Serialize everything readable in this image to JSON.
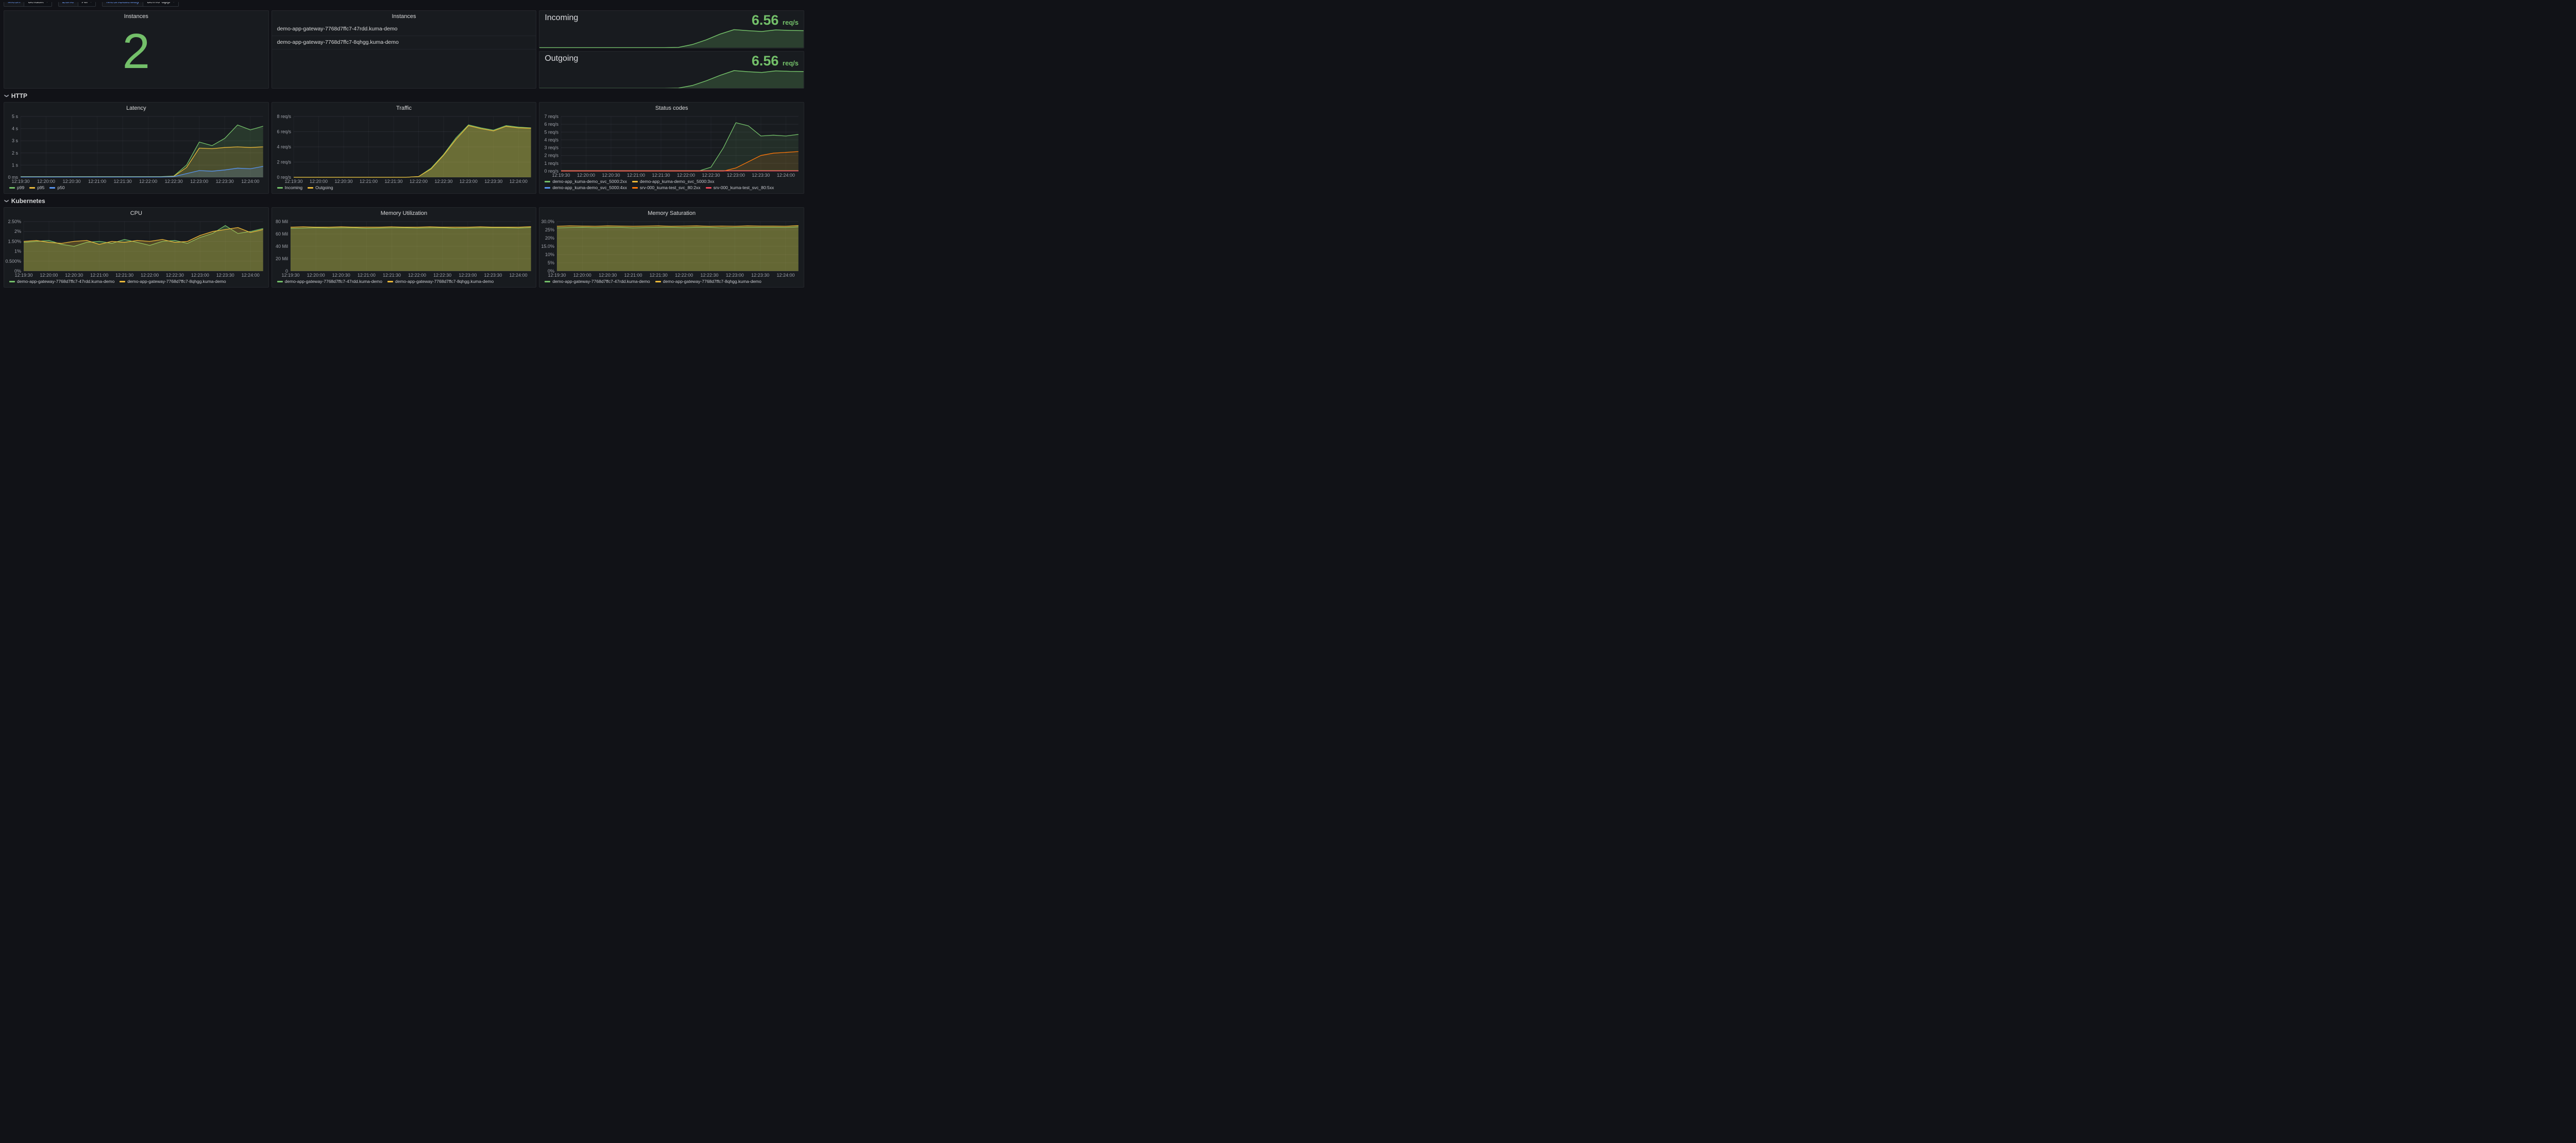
{
  "colors": {
    "green": "#73BF69",
    "yellow": "#EAB839",
    "blue": "#5794F2",
    "orange": "#FF780A",
    "red": "#F2495C"
  },
  "topbar": {
    "filters": [
      {
        "label": "Mesh",
        "value": "default"
      },
      {
        "label": "Zone",
        "value": "All"
      },
      {
        "label": "MeshGateway",
        "value": "demo-app"
      }
    ]
  },
  "sections": [
    {
      "title": "HTTP"
    },
    {
      "title": "Kubernetes"
    }
  ],
  "panels": {
    "instances_stat": {
      "title": "Instances",
      "value": "2"
    },
    "instances_list": {
      "title": "Instances",
      "items": [
        "demo-app-gateway-7768d7ffc7-47rdd.kuma-demo",
        "demo-app-gateway-7768d7ffc7-8qhgg.kuma-demo"
      ]
    },
    "incoming": {
      "title": "Incoming",
      "value": "6.56",
      "unit": "req/s"
    },
    "outgoing": {
      "title": "Outgoing",
      "value": "6.56",
      "unit": "req/s"
    }
  },
  "chart_data": [
    {
      "type": "line",
      "title": "Latency",
      "ylim": [
        0,
        5
      ],
      "yticks": [
        [
          0,
          "0 ms"
        ],
        [
          1,
          "1 s"
        ],
        [
          2,
          "2 s"
        ],
        [
          3,
          "3 s"
        ],
        [
          4,
          "4 s"
        ],
        [
          5,
          "5 s"
        ]
      ],
      "x_labels": [
        "12:19:30",
        "12:20:00",
        "12:20:30",
        "12:21:00",
        "12:21:30",
        "12:22:00",
        "12:22:30",
        "12:23:00",
        "12:23:30",
        "12:24:00"
      ],
      "x_label_step": 2,
      "series": [
        {
          "name": "p99",
          "color": "#73BF69",
          "values": [
            0.05,
            0.05,
            0.05,
            0.05,
            0.05,
            0.05,
            0.05,
            0.05,
            0.05,
            0.05,
            0.05,
            0.05,
            0.1,
            1.0,
            2.9,
            2.6,
            3.2,
            4.3,
            3.9,
            4.2
          ]
        },
        {
          "name": "p95",
          "color": "#EAB839",
          "values": [
            0.03,
            0.03,
            0.03,
            0.03,
            0.03,
            0.03,
            0.03,
            0.03,
            0.03,
            0.03,
            0.03,
            0.03,
            0.08,
            0.8,
            2.4,
            2.35,
            2.45,
            2.5,
            2.45,
            2.5
          ]
        },
        {
          "name": "p50",
          "color": "#5794F2",
          "values": [
            0.02,
            0.02,
            0.02,
            0.02,
            0.02,
            0.02,
            0.02,
            0.02,
            0.02,
            0.02,
            0.02,
            0.02,
            0.05,
            0.3,
            0.55,
            0.5,
            0.6,
            0.75,
            0.7,
            0.9
          ]
        }
      ]
    },
    {
      "type": "area",
      "title": "Traffic",
      "ylim": [
        0,
        8
      ],
      "yticks": [
        [
          0,
          "0 req/s"
        ],
        [
          2,
          "2 req/s"
        ],
        [
          4,
          "4 req/s"
        ],
        [
          6,
          "6 req/s"
        ],
        [
          8,
          "8 req/s"
        ]
      ],
      "x_labels": [
        "12:19:30",
        "12:20:00",
        "12:20:30",
        "12:21:00",
        "12:21:30",
        "12:22:00",
        "12:22:30",
        "12:23:00",
        "12:23:30",
        "12:24:00"
      ],
      "x_label_step": 2,
      "series": [
        {
          "name": "Incoming",
          "color": "#73BF69",
          "values": [
            0,
            0,
            0,
            0,
            0,
            0,
            0,
            0,
            0,
            0,
            0.1,
            1.2,
            3.0,
            5.2,
            6.9,
            6.5,
            6.2,
            6.8,
            6.6,
            6.5
          ]
        },
        {
          "name": "Outgoing",
          "color": "#EAB839",
          "values": [
            0,
            0,
            0,
            0,
            0,
            0,
            0,
            0,
            0,
            0,
            0.1,
            1.1,
            2.9,
            5.0,
            6.8,
            6.4,
            6.1,
            6.7,
            6.5,
            6.45
          ]
        }
      ]
    },
    {
      "type": "line",
      "title": "Status codes",
      "ylim": [
        0,
        7
      ],
      "yticks": [
        [
          0,
          "0 req/s"
        ],
        [
          1,
          "1 req/s"
        ],
        [
          2,
          "2 req/s"
        ],
        [
          3,
          "3 req/s"
        ],
        [
          4,
          "4 req/s"
        ],
        [
          5,
          "5 req/s"
        ],
        [
          6,
          "6 req/s"
        ],
        [
          7,
          "7 req/s"
        ]
      ],
      "x_labels": [
        "12:19:30",
        "12:20:00",
        "12:20:30",
        "12:21:00",
        "12:21:30",
        "12:22:00",
        "12:22:30",
        "12:23:00",
        "12:23:30",
        "12:24:00"
      ],
      "x_label_step": 2,
      "series": [
        {
          "name": "demo-app_kuma-demo_svc_5000:2xx",
          "color": "#73BF69",
          "values": [
            0,
            0,
            0,
            0,
            0,
            0,
            0,
            0,
            0,
            0,
            0,
            0,
            0.5,
            3.0,
            6.2,
            5.8,
            4.5,
            4.6,
            4.5,
            4.7
          ]
        },
        {
          "name": "demo-app_kuma-demo_svc_5000:3xx",
          "color": "#EAB839",
          "values": [
            0.05,
            0.05,
            0.05,
            0.05,
            0.05,
            0.05,
            0.05,
            0.05,
            0.05,
            0.05,
            0.05,
            0.05,
            0.05,
            0.05,
            0.05,
            0.05,
            0.05,
            0.05,
            0.05,
            0.05
          ]
        },
        {
          "name": "demo-app_kuma-demo_svc_5000:4xx",
          "color": "#5794F2",
          "values": [
            0.03,
            0.03,
            0.03,
            0.03,
            0.03,
            0.03,
            0.03,
            0.03,
            0.03,
            0.03,
            0.03,
            0.03,
            0.03,
            0.03,
            0.03,
            0.03,
            0.03,
            0.03,
            0.03,
            0.03
          ]
        },
        {
          "name": "srv-000_kuma-test_svc_80:2xx",
          "color": "#FF780A",
          "values": [
            0,
            0,
            0,
            0,
            0,
            0,
            0,
            0,
            0,
            0,
            0,
            0,
            0,
            0,
            0.4,
            1.2,
            2.0,
            2.3,
            2.4,
            2.5
          ]
        },
        {
          "name": "srv-000_kuma-test_svc_80:5xx",
          "color": "#F2495C",
          "values": [
            0.02,
            0.02,
            0.02,
            0.02,
            0.02,
            0.02,
            0.02,
            0.02,
            0.02,
            0.02,
            0.02,
            0.02,
            0.02,
            0.02,
            0.02,
            0.02,
            0.02,
            0.02,
            0.02,
            0.02
          ]
        }
      ]
    },
    {
      "type": "line",
      "title": "CPU",
      "ylim": [
        0,
        2.5
      ],
      "yticks": [
        [
          0,
          "0%"
        ],
        [
          0.5,
          "0.500%"
        ],
        [
          1,
          "1%"
        ],
        [
          1.5,
          "1.50%"
        ],
        [
          2,
          "2%"
        ],
        [
          2.5,
          "2.50%"
        ]
      ],
      "x_labels": [
        "12:19:30",
        "12:20:00",
        "12:20:30",
        "12:21:00",
        "12:21:30",
        "12:22:00",
        "12:22:30",
        "12:23:00",
        "12:23:30",
        "12:24:00"
      ],
      "x_label_step": 2,
      "series": [
        {
          "name": "demo-app-gateway-7768d7ffc7-47rdd.kuma-demo",
          "color": "#73BF69",
          "values": [
            1.45,
            1.5,
            1.55,
            1.35,
            1.25,
            1.45,
            1.5,
            1.4,
            1.6,
            1.45,
            1.3,
            1.5,
            1.55,
            1.4,
            1.7,
            1.9,
            2.3,
            1.9,
            2.0,
            2.15
          ]
        },
        {
          "name": "demo-app-gateway-7768d7ffc7-8qhgg.kuma-demo",
          "color": "#EAB839",
          "values": [
            1.5,
            1.55,
            1.45,
            1.4,
            1.5,
            1.55,
            1.35,
            1.5,
            1.45,
            1.55,
            1.5,
            1.6,
            1.45,
            1.5,
            1.8,
            2.0,
            2.1,
            2.2,
            1.95,
            2.1
          ]
        }
      ]
    },
    {
      "type": "line",
      "title": "Memory Utilization",
      "ylim": [
        0,
        80
      ],
      "yticks": [
        [
          0,
          "0"
        ],
        [
          20,
          "20 Mil"
        ],
        [
          40,
          "40 Mil"
        ],
        [
          60,
          "60 Mil"
        ],
        [
          80,
          "80 Mil"
        ]
      ],
      "x_labels": [
        "12:19:30",
        "12:20:00",
        "12:20:30",
        "12:21:00",
        "12:21:30",
        "12:22:00",
        "12:22:30",
        "12:23:00",
        "12:23:30",
        "12:24:00"
      ],
      "x_label_step": 2,
      "series": [
        {
          "name": "demo-app-gateway-7768d7ffc7-47rdd.kuma-demo",
          "color": "#73BF69",
          "values": [
            69,
            69.5,
            70,
            69.5,
            70,
            70,
            69,
            69.5,
            70,
            70,
            69.5,
            70,
            70,
            69,
            69.5,
            70,
            70,
            70,
            69.5,
            70.5
          ]
        },
        {
          "name": "demo-app-gateway-7768d7ffc7-8qhgg.kuma-demo",
          "color": "#EAB839",
          "values": [
            71,
            71.5,
            71,
            71,
            71.5,
            71,
            71,
            71,
            71.5,
            71,
            71,
            71.5,
            71,
            71,
            71,
            71.5,
            71,
            71,
            71,
            71.8
          ]
        }
      ]
    },
    {
      "type": "line",
      "title": "Memory Saturation",
      "ylim": [
        0,
        30
      ],
      "yticks": [
        [
          0,
          "0%"
        ],
        [
          5,
          "5%"
        ],
        [
          10,
          "10%"
        ],
        [
          15,
          "15.0%"
        ],
        [
          20,
          "20%"
        ],
        [
          25,
          "25%"
        ],
        [
          30,
          "30.0%"
        ]
      ],
      "x_labels": [
        "12:19:30",
        "12:20:00",
        "12:20:30",
        "12:21:00",
        "12:21:30",
        "12:22:00",
        "12:22:30",
        "12:23:00",
        "12:23:30",
        "12:24:00"
      ],
      "x_label_step": 2,
      "series": [
        {
          "name": "demo-app-gateway-7768d7ffc7-47rdd.kuma-demo",
          "color": "#73BF69",
          "values": [
            26.2,
            26.4,
            26.5,
            26.3,
            26.5,
            26.5,
            26.2,
            26.4,
            26.5,
            26.5,
            26.3,
            26.5,
            26.5,
            26.2,
            26.4,
            26.5,
            26.5,
            26.5,
            26.4,
            26.8
          ]
        },
        {
          "name": "demo-app-gateway-7768d7ffc7-8qhgg.kuma-demo",
          "color": "#EAB839",
          "values": [
            27.2,
            27.4,
            27.3,
            27.2,
            27.4,
            27.3,
            27.2,
            27.3,
            27.4,
            27.2,
            27.3,
            27.4,
            27.2,
            27.3,
            27.2,
            27.4,
            27.3,
            27.3,
            27.2,
            27.6
          ]
        }
      ]
    },
    {
      "type": "area",
      "title": "Incoming sparkline",
      "ylim": [
        0,
        7.2
      ],
      "series": [
        {
          "name": "Incoming",
          "color": "#73BF69",
          "values": [
            0,
            0,
            0,
            0,
            0,
            0,
            0,
            0,
            0,
            0,
            0.1,
            1.2,
            3.0,
            5.2,
            6.9,
            6.5,
            6.2,
            6.8,
            6.6,
            6.5
          ]
        }
      ]
    },
    {
      "type": "area",
      "title": "Outgoing sparkline",
      "ylim": [
        0,
        7.2
      ],
      "series": [
        {
          "name": "Outgoing",
          "color": "#73BF69",
          "values": [
            0,
            0,
            0,
            0,
            0,
            0,
            0,
            0,
            0,
            0,
            0.1,
            1.1,
            2.9,
            5.0,
            6.8,
            6.4,
            6.1,
            6.7,
            6.5,
            6.45
          ]
        }
      ]
    }
  ]
}
